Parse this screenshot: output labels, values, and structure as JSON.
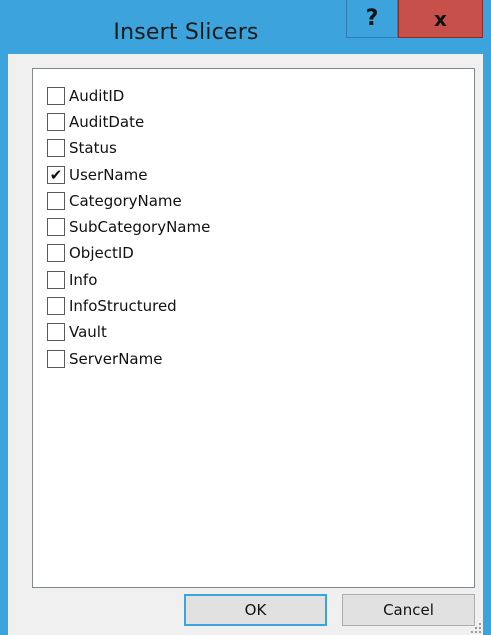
{
  "dialog": {
    "title": "Insert Slicers",
    "help_label": "?",
    "close_label": "x"
  },
  "fields": [
    {
      "label": "AuditID",
      "checked": false
    },
    {
      "label": "AuditDate",
      "checked": false
    },
    {
      "label": "Status",
      "checked": false
    },
    {
      "label": "UserName",
      "checked": true
    },
    {
      "label": "CategoryName",
      "checked": false
    },
    {
      "label": "SubCategoryName",
      "checked": false
    },
    {
      "label": "ObjectID",
      "checked": false
    },
    {
      "label": "Info",
      "checked": false
    },
    {
      "label": "InfoStructured",
      "checked": false
    },
    {
      "label": "Vault",
      "checked": false
    },
    {
      "label": "ServerName",
      "checked": false
    }
  ],
  "buttons": {
    "ok_label": "OK",
    "cancel_label": "Cancel"
  },
  "icons": {
    "check": "✔"
  },
  "colors": {
    "titlebar": "#3ca3dc",
    "close": "#c7504b"
  }
}
